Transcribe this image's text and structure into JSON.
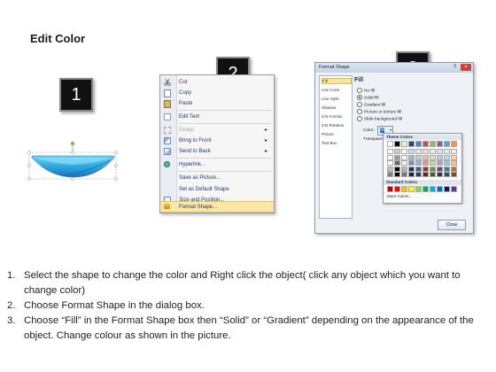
{
  "page": {
    "title": "Edit Color"
  },
  "step_badges": [
    "1",
    "2",
    "3"
  ],
  "colors": {
    "shape_fill_light": "#4fc3ec",
    "shape_fill_dark": "#1e88c7",
    "badge_bg": "#111111",
    "menu_highlight": "#fbe7a6"
  },
  "context_menu": {
    "items": [
      {
        "label": "Cut",
        "underline_hint": "t",
        "icon": "scissors-icon",
        "disabled": false,
        "submenu": false
      },
      {
        "label": "Copy",
        "icon": "copy-icon",
        "disabled": false,
        "submenu": false
      },
      {
        "label": "Paste",
        "icon": "paste-icon",
        "disabled": false,
        "submenu": false
      },
      {
        "label": "Edit Text",
        "icon": "edit-text-icon",
        "disabled": false,
        "submenu": false
      },
      {
        "label": "Group",
        "icon": "group-icon",
        "disabled": true,
        "submenu": true
      },
      {
        "label": "Bring to Front",
        "icon": "bring-front-icon",
        "disabled": false,
        "submenu": true
      },
      {
        "label": "Send to Back",
        "icon": "send-back-icon",
        "disabled": false,
        "submenu": true
      },
      {
        "label": "Hyperlink...",
        "icon": "hyperlink-icon",
        "disabled": false,
        "submenu": false
      },
      {
        "label": "Save as Picture...",
        "icon": "",
        "disabled": false,
        "submenu": false
      },
      {
        "label": "Set as Default Shape",
        "icon": "",
        "disabled": false,
        "submenu": false
      },
      {
        "label": "Size and Position...",
        "icon": "size-icon",
        "disabled": false,
        "submenu": false
      },
      {
        "label": "Format Shape...",
        "icon": "format-shape-icon",
        "disabled": false,
        "submenu": false,
        "highlighted": true
      }
    ]
  },
  "dialog": {
    "title": "Format Shape",
    "help": "?",
    "close_x": "×",
    "nav": [
      "Fill",
      "Line Color",
      "Line Style",
      "Shadow",
      "3-D Format",
      "3-D Rotation",
      "Picture",
      "Text Box"
    ],
    "heading": "Fill",
    "options": [
      "No fill",
      "Solid fill",
      "Gradient fill",
      "Picture or texture fill",
      "Slide background fill"
    ],
    "selected_option": "Solid fill",
    "color_label": "Color:",
    "transparency_label": "Transparency:",
    "theme_colors_label": "Theme Colors",
    "standard_colors_label": "Standard Colors",
    "more_colors": "More Colors...",
    "close_button": "Close",
    "theme_top_row": [
      "#ffffff",
      "#000000",
      "#eeece1",
      "#1f497d",
      "#4f81bd",
      "#c0504d",
      "#9bbb59",
      "#8064a2",
      "#4bacc6",
      "#f79646"
    ],
    "standard_row": [
      "#c00000",
      "#ff0000",
      "#ffc000",
      "#ffff00",
      "#92d050",
      "#00b050",
      "#00b0f0",
      "#0070c0",
      "#002060",
      "#7030a0"
    ]
  },
  "instructions": [
    {
      "num": "1.",
      "text": "Select the shape to change the color and Right click the object( click any object which you want to change color)"
    },
    {
      "num": "2.",
      "text": "Choose Format Shape in the dialog box."
    },
    {
      "num": "3.",
      "text": "Choose “Fill” in the Format Shape box then “Solid” or “Gradient” depending on the appearance of the object. Change colour as shown in the picture."
    }
  ]
}
